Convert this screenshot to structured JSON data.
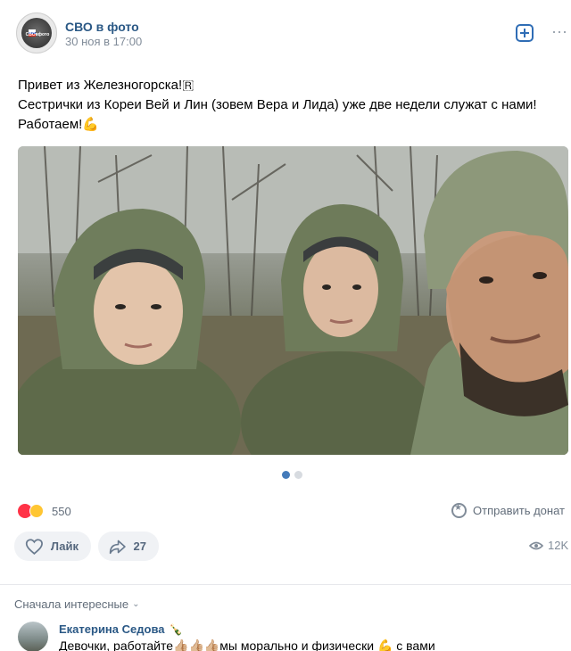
{
  "post": {
    "author": "СВО в фото",
    "avatar_label": "СВОвфото",
    "date": "30 ноя в 17:00",
    "text_lines": [
      "Привет из Железногорска!🇷",
      "Сестрички из Кореи Вей и Лин (зовем Вера и Лида) уже две недели служат с нами!",
      "Работаем!💪"
    ],
    "photo": {
      "description_icon": "photo-image",
      "carousel_total": 2,
      "carousel_active": 1
    }
  },
  "stats": {
    "reactions_count": "550",
    "reaction_icons": [
      "heart-eyes-icon",
      "laugh-icon"
    ],
    "donate_label": "Отправить донат",
    "like_label": "Лайк",
    "share_count": "27",
    "views": "12K"
  },
  "comments": {
    "sort_label": "Сначала интересные",
    "first": {
      "author": "Екатерина Седова",
      "badge": "🍾",
      "text": "Девочки, работайте👍🏼👍🏼👍🏼мы морально и физически 💪 с вами"
    }
  },
  "colors": {
    "link": "#2a5885",
    "accent": "#2f6db5",
    "muted": "#818c99",
    "button_bg": "#f0f2f5"
  }
}
